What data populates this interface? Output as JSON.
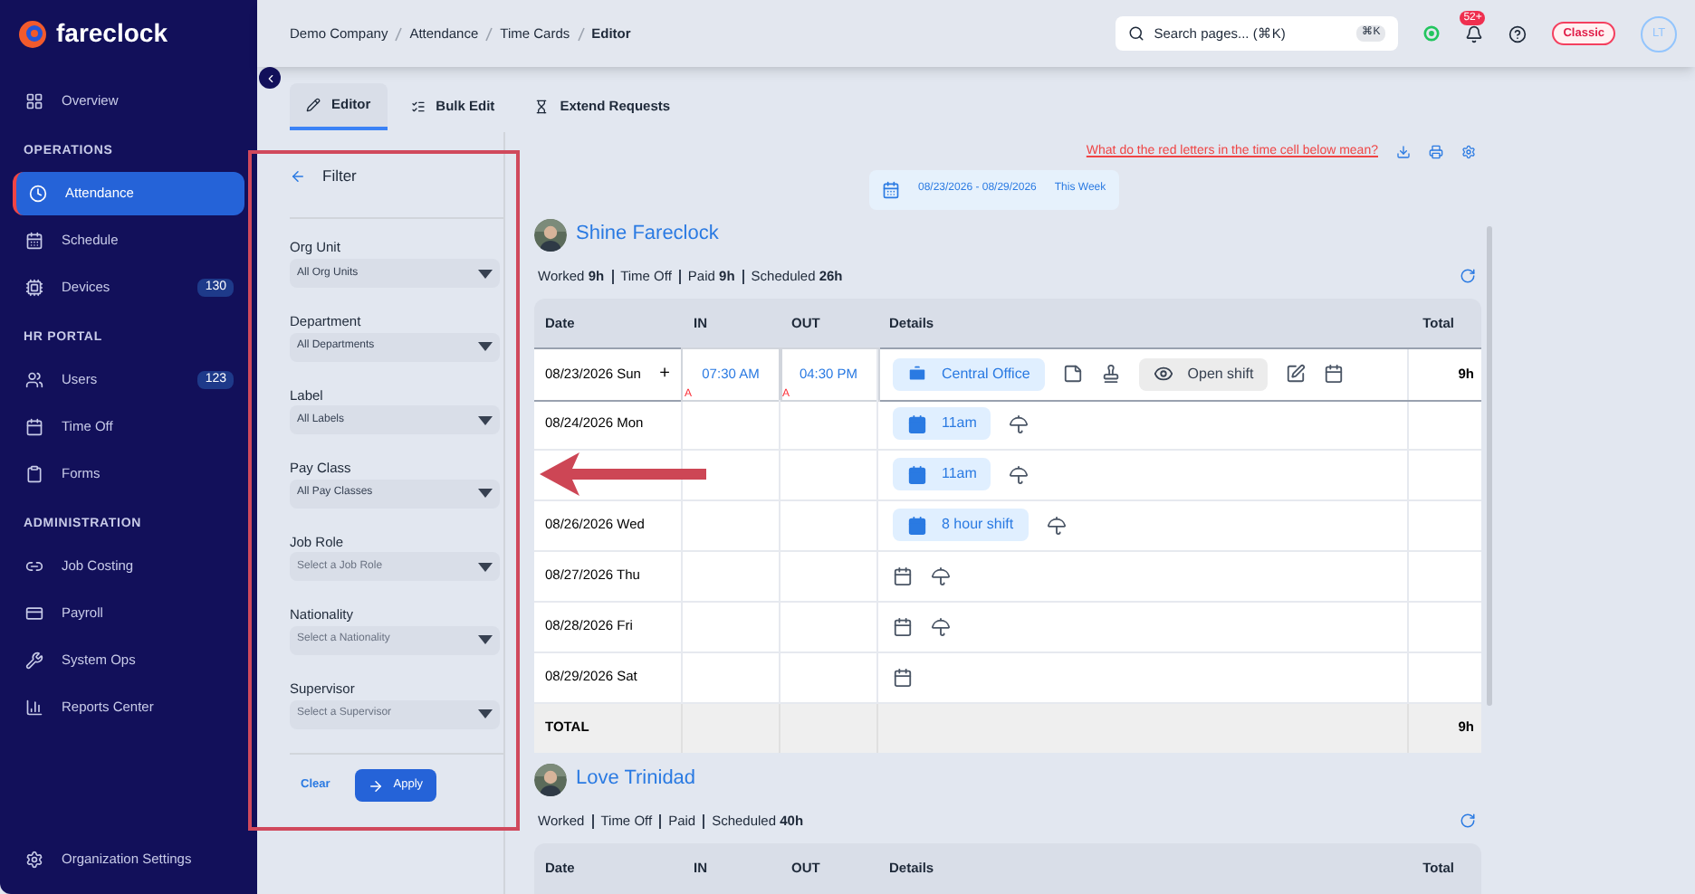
{
  "brand": "fareclock",
  "sidebar": {
    "sections": [
      {
        "items": [
          {
            "label": "Overview",
            "selected": false
          }
        ]
      },
      {
        "heading": "OPERATIONS",
        "items": [
          {
            "label": "Attendance",
            "selected": true
          },
          {
            "label": "Schedule",
            "selected": false
          },
          {
            "label": "Devices",
            "selected": false,
            "badge": "130"
          }
        ]
      },
      {
        "heading": "HR PORTAL",
        "items": [
          {
            "label": "Users",
            "selected": false,
            "badge": "123"
          },
          {
            "label": "Time Off",
            "selected": false
          },
          {
            "label": "Forms",
            "selected": false
          }
        ]
      },
      {
        "heading": "ADMINISTRATION",
        "items": [
          {
            "label": "Job Costing",
            "selected": false
          },
          {
            "label": "Payroll",
            "selected": false
          },
          {
            "label": "System Ops",
            "selected": false
          },
          {
            "label": "Reports Center",
            "selected": false
          }
        ]
      }
    ],
    "footer": "Organization Settings"
  },
  "breadcrumb": [
    "Demo Company",
    "Attendance",
    "Time Cards",
    "Editor"
  ],
  "search": {
    "placeholder": "Search pages... (⌘K)",
    "shortcut": "⌘K"
  },
  "notifications_badge": "52+",
  "mode_badge": "Classic",
  "avatar": "LT",
  "tabs": [
    {
      "label": "Editor",
      "selected": true
    },
    {
      "label": "Bulk Edit",
      "selected": false
    },
    {
      "label": "Extend Requests",
      "selected": false
    }
  ],
  "filter": {
    "title": "Filter",
    "fields": [
      {
        "label": "Org Unit",
        "value": "All Org Units"
      },
      {
        "label": "Department",
        "value": "All Departments"
      },
      {
        "label": "Label",
        "value": "All Labels"
      },
      {
        "label": "Pay Class",
        "value": "All Pay Classes"
      },
      {
        "label": "Job Role",
        "placeholder": "Select a Job Role"
      },
      {
        "label": "Nationality",
        "placeholder": "Select a Nationality"
      },
      {
        "label": "Supervisor",
        "placeholder": "Select a Supervisor"
      }
    ],
    "clear": "Clear",
    "apply": "Apply"
  },
  "help_link": "What do the red letters in the time cell below mean?",
  "date_range": {
    "range": "08/23/2026 - 08/29/2026",
    "label": "This Week"
  },
  "employees": [
    {
      "name": "Shine Fareclock",
      "summary": [
        {
          "label": "Worked",
          "value": "9h"
        },
        {
          "label": "Time Off"
        },
        {
          "label": "Paid",
          "value": "9h"
        },
        {
          "label": "Scheduled",
          "value": "26h"
        }
      ],
      "columns": [
        "Date",
        "IN",
        "OUT",
        "Details",
        "Total"
      ],
      "rows": [
        {
          "date": "08/23/2026 Sun",
          "selected": true,
          "add": "+",
          "in": "07:30 AM",
          "in_flag": "A",
          "out": "04:30 PM",
          "out_flag": "A",
          "total": "9h",
          "details": [
            {
              "kind": "location",
              "text": "Central Office"
            },
            {
              "kind": "note"
            },
            {
              "kind": "stamp"
            },
            {
              "kind": "viewer",
              "text": "Open shift"
            },
            {
              "kind": "edit"
            },
            {
              "kind": "schedule"
            }
          ]
        },
        {
          "date": "08/24/2026 Mon",
          "selected": false,
          "details": [
            {
              "kind": "shift",
              "text": "11am"
            },
            {
              "kind": "vacation"
            }
          ]
        },
        {
          "selected": false,
          "details": [
            {
              "kind": "shift",
              "text": "11am"
            },
            {
              "kind": "vacation"
            }
          ]
        },
        {
          "date": "08/26/2026 Wed",
          "selected": false,
          "details": [
            {
              "kind": "shift",
              "text": "8 hour shift"
            },
            {
              "kind": "vacation"
            }
          ]
        },
        {
          "date": "08/27/2026 Thu",
          "selected": false,
          "details": [
            {
              "kind": "schedule"
            },
            {
              "kind": "vacation"
            }
          ]
        },
        {
          "date": "08/28/2026 Fri",
          "selected": false,
          "details": [
            {
              "kind": "schedule"
            },
            {
              "kind": "vacation"
            }
          ]
        },
        {
          "date": "08/29/2026 Sat",
          "selected": false,
          "details": [
            {
              "kind": "schedule"
            }
          ]
        }
      ],
      "total": {
        "label": "TOTAL",
        "value": "9h"
      }
    },
    {
      "name": "Love Trinidad",
      "summary": [
        {
          "label": "Worked"
        },
        {
          "label": "Time Off"
        },
        {
          "label": "Paid"
        },
        {
          "label": "Scheduled",
          "value": "40h"
        }
      ],
      "columns": [
        "Date",
        "IN",
        "OUT",
        "Details",
        "Total"
      ]
    }
  ]
}
